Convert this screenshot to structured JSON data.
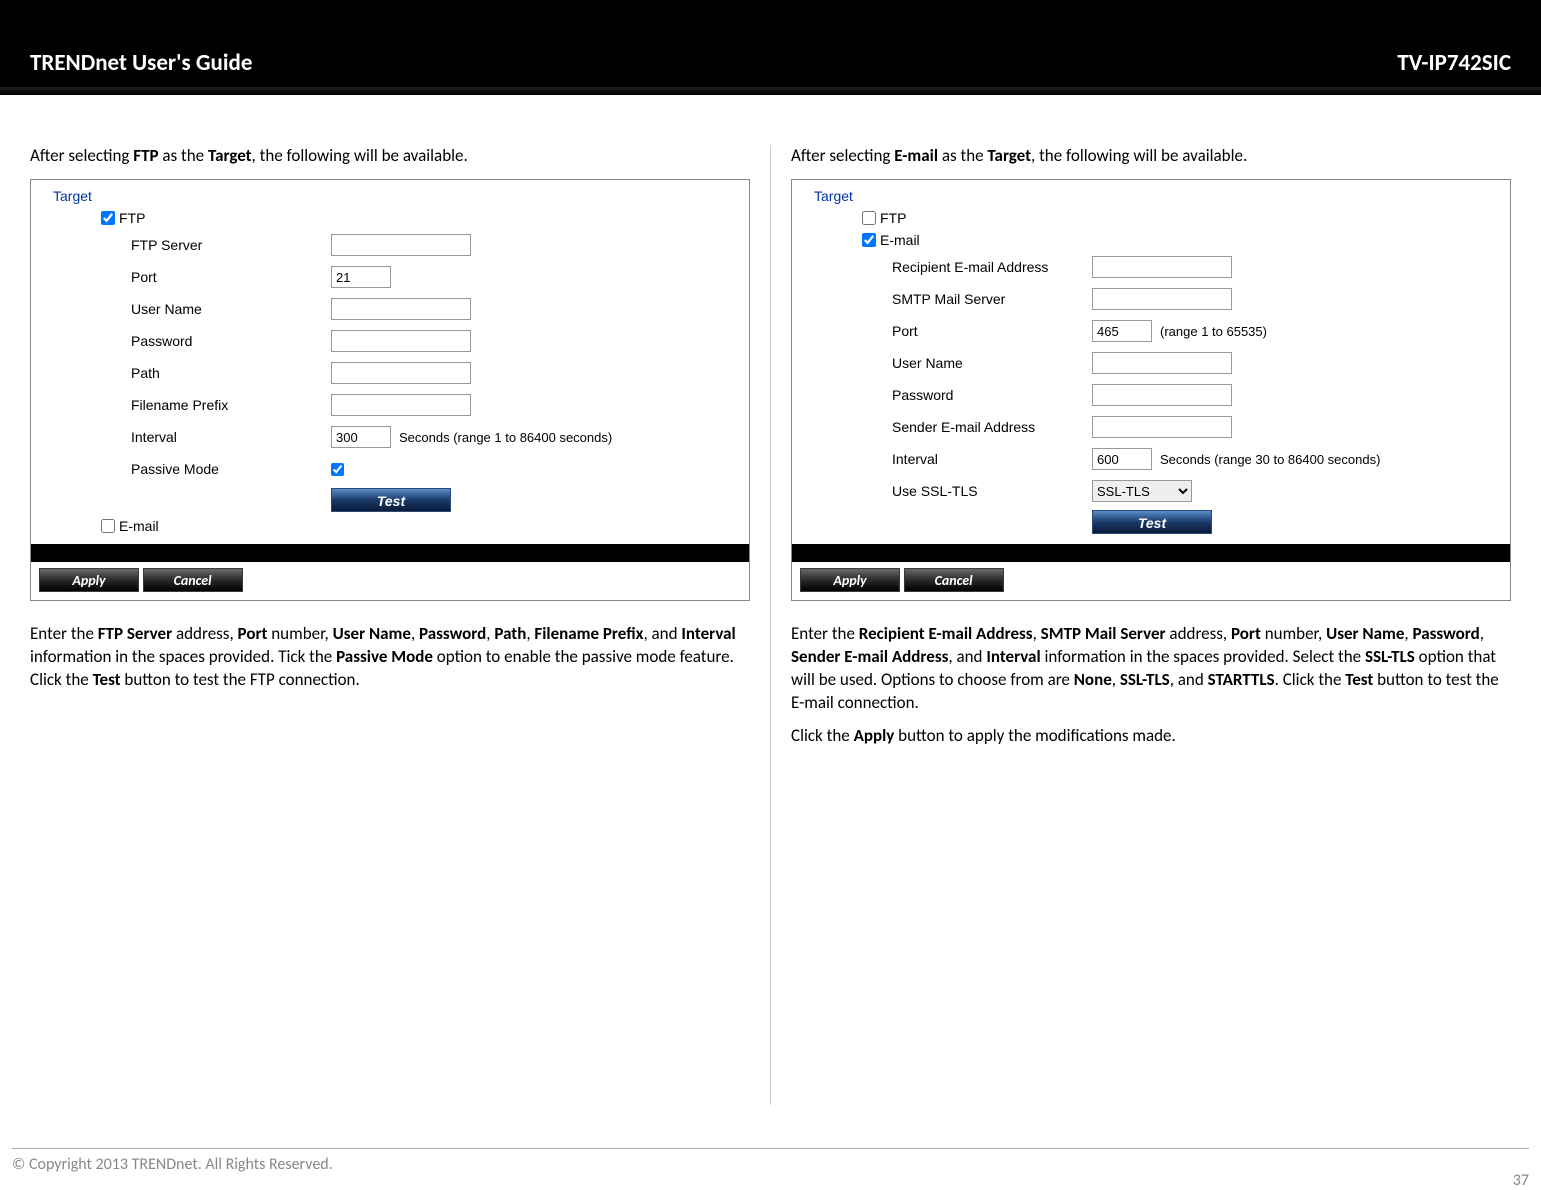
{
  "header": {
    "title": "TRENDnet User's Guide",
    "model": "TV-IP742SIC"
  },
  "left": {
    "intro_pre": "After selecting ",
    "intro_b1": "FTP",
    "intro_mid": " as the ",
    "intro_b2": "Target",
    "intro_post": ", the following will be available.",
    "target_label": "Target",
    "ftp_label": "FTP",
    "fields": {
      "ftp_server": "FTP Server",
      "port": "Port",
      "port_val": "21",
      "user": "User Name",
      "password": "Password",
      "path": "Path",
      "prefix": "Filename Prefix",
      "interval": "Interval",
      "interval_val": "300",
      "interval_hint": "Seconds  (range 1 to 86400 seconds)",
      "passive": "Passive Mode"
    },
    "test": "Test",
    "email_label": "E-mail",
    "apply": "Apply",
    "cancel": "Cancel",
    "para": {
      "t1": "Enter the ",
      "b1": "FTP Server",
      "t2": " address, ",
      "b2": "Port",
      "t3": " number, ",
      "b3": "User Name",
      "t4": ", ",
      "b4": "Password",
      "t5": ", ",
      "b5": "Path",
      "t6": ", ",
      "b6": "Filename Prefix",
      "t7": ", and ",
      "b7": "Interval",
      "t8": " information in the spaces provided. Tick the ",
      "b8": "Passive Mode",
      "t9": " option to enable the passive mode feature. Click the ",
      "b9": "Test",
      "t10": " button to test the FTP connection."
    }
  },
  "right": {
    "intro_pre": "After selecting ",
    "intro_b1": "E-mail",
    "intro_mid": " as the ",
    "intro_b2": "Target",
    "intro_post": ", the following will be available.",
    "target_label": "Target",
    "ftp_label": "FTP",
    "email_label": "E-mail",
    "fields": {
      "recipient": "Recipient E-mail Address",
      "smtp": "SMTP Mail Server",
      "port": "Port",
      "port_val": "465",
      "port_hint": "(range 1 to 65535)",
      "user": "User Name",
      "password": "Password",
      "sender": "Sender E-mail Address",
      "interval": "Interval",
      "interval_val": "600",
      "interval_hint": "Seconds  (range 30 to 86400 seconds)",
      "ssl": "Use SSL-TLS",
      "ssl_val": "SSL-TLS"
    },
    "test": "Test",
    "apply": "Apply",
    "cancel": "Cancel",
    "para": {
      "t1": "Enter the ",
      "b1": "Recipient E-mail Address",
      "t2": ", ",
      "b2": "SMTP Mail Server",
      "t3": " address, ",
      "b3": "Port",
      "t4": " number, ",
      "b4": "User Name",
      "t5": ", ",
      "b5": "Password",
      "t6": ", ",
      "b6": "Sender E-mail Address",
      "t7": ", and ",
      "b7": "Interval",
      "t8": " information in the spaces provided. Select the ",
      "b8": "SSL-TLS",
      "t9": " option that will be used. Options to choose from are ",
      "b9": "None",
      "t10": ", ",
      "b10": "SSL-TLS",
      "t11": ", and ",
      "b11": "STARTTLS",
      "t12": ". Click the ",
      "b12": "Test",
      "t13": " button to test the E-mail connection."
    },
    "para2": {
      "t1": "Click the ",
      "b1": "Apply",
      "t2": " button to apply the modifications made."
    }
  },
  "footer": {
    "copyright": "© Copyright 2013 TRENDnet. All Rights Reserved.",
    "page": "37"
  }
}
